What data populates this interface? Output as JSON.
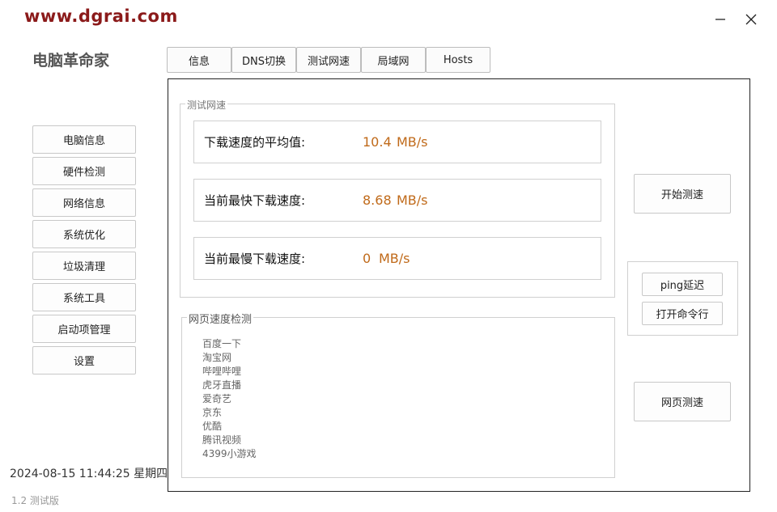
{
  "watermark": "www.dgrai.com",
  "app_title": "电脑革命家",
  "window": {
    "minimize_icon": "minimize-icon",
    "close_icon": "close-icon"
  },
  "tabs": [
    {
      "label": "信息"
    },
    {
      "label": "DNS切换"
    },
    {
      "label": "测试网速"
    },
    {
      "label": "局域网"
    },
    {
      "label": "Hosts"
    }
  ],
  "sidebar": {
    "items": [
      {
        "label": "电脑信息"
      },
      {
        "label": "硬件检测"
      },
      {
        "label": "网络信息"
      },
      {
        "label": "系统优化"
      },
      {
        "label": "垃圾清理"
      },
      {
        "label": "系统工具"
      },
      {
        "label": "启动项管理"
      },
      {
        "label": "设置"
      }
    ]
  },
  "speed_test": {
    "group_title": "测试网速",
    "rows": [
      {
        "label": "下载速度的平均值:",
        "value": "10.4",
        "unit": "MB/s"
      },
      {
        "label": "当前最快下载速度:",
        "value": "8.68",
        "unit": "MB/s"
      },
      {
        "label": "当前最慢下载速度:",
        "value": "0",
        "unit": "MB/s"
      }
    ],
    "start_button": "开始测速"
  },
  "tools": {
    "ping_button": "ping延迟",
    "cmd_button": "打开命令行"
  },
  "web_speed": {
    "group_title": "网页速度检测",
    "sites": [
      "百度一下",
      "淘宝网",
      "哔哩哔哩",
      "虎牙直播",
      "爱奇艺",
      "京东",
      "优酷",
      "腾讯视频",
      "4399小游戏"
    ],
    "test_button": "网页测速"
  },
  "status": {
    "datetime": "2024-08-15 11:44:25  星期四",
    "version": "1.2  测试版"
  },
  "colors": {
    "accent_value": "#c06a1a",
    "watermark": "#8b1a1a"
  }
}
